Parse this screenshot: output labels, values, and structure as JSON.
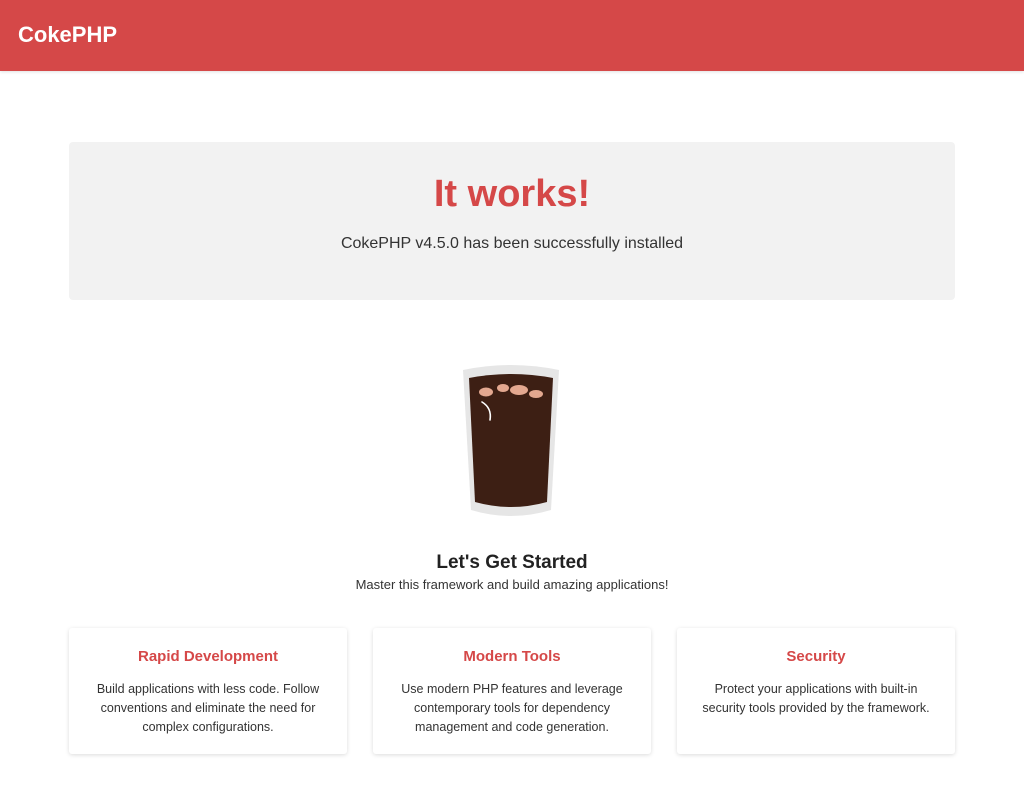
{
  "header": {
    "brand": "CokePHP"
  },
  "hero": {
    "title": "It works!",
    "subtitle": "CokePHP v4.5.0 has been successfully installed"
  },
  "illustration": {
    "icon": "soda-glass-icon"
  },
  "intro": {
    "title": "Let's Get Started",
    "subtitle": "Master this framework and build amazing applications!"
  },
  "features": [
    {
      "title": "Rapid Development",
      "text": "Build applications with less code. Follow conventions and eliminate the need for complex configurations."
    },
    {
      "title": "Modern Tools",
      "text": "Use modern PHP features and leverage contemporary tools for dependency management and code generation."
    },
    {
      "title": "Security",
      "text": "Protect your applications with built-in security tools provided by the framework."
    }
  ],
  "colors": {
    "brand": "#d54848",
    "hero_bg": "#f2f2f2",
    "cola": "#3d1f14",
    "bubble": "#e3a890"
  }
}
